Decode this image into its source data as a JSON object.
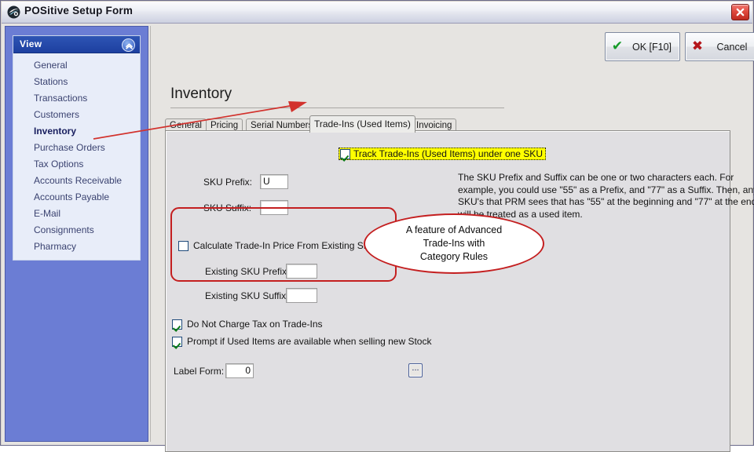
{
  "window": {
    "title": "POSitive Setup Form",
    "icon": "app-logo-icon",
    "close_label": "✕"
  },
  "sidebar": {
    "header": "View",
    "collapse_icon": "chevron-up-circle-icon",
    "items": [
      {
        "label": "General",
        "active": false
      },
      {
        "label": "Stations",
        "active": false
      },
      {
        "label": "Transactions",
        "active": false
      },
      {
        "label": "Customers",
        "active": false
      },
      {
        "label": "Inventory",
        "active": true
      },
      {
        "label": "Purchase Orders",
        "active": false
      },
      {
        "label": "Tax Options",
        "active": false
      },
      {
        "label": "Accounts Receivable",
        "active": false
      },
      {
        "label": "Accounts Payable",
        "active": false
      },
      {
        "label": "E-Mail",
        "active": false
      },
      {
        "label": "Consignments",
        "active": false
      },
      {
        "label": "Pharmacy",
        "active": false
      }
    ]
  },
  "toolbar": {
    "ok_label": "OK [F10]",
    "ok_icon": "check-icon",
    "cancel_label": "Cancel",
    "cancel_icon": "x-icon"
  },
  "main": {
    "page_title": "Inventory",
    "tabs": [
      {
        "label": "General",
        "active": false
      },
      {
        "label": "Pricing",
        "active": false
      },
      {
        "label": "Serial Numbers",
        "active": false
      },
      {
        "label": "Trade-Ins (Used Items)",
        "active": true
      },
      {
        "label": "Invoicing",
        "active": false
      }
    ]
  },
  "form": {
    "track_tradeins": {
      "label": "Track Trade-Ins (Used Items) under one SKU",
      "checked": true,
      "highlight_color": "#ffff00"
    },
    "sku_prefix": {
      "label": "SKU Prefix:",
      "value": "U",
      "placeholder": ""
    },
    "sku_suffix": {
      "label": "SKU Suffix:",
      "value": "",
      "placeholder": ""
    },
    "help_text": "The SKU Prefix and Suffix can be one or two characters each.  For example, you could use \"55\" as a Prefix, and \"77\" as a Suffix.  Then, any SKU's that PRM sees that has \"55\" at the beginning and \"77\" at the end will be treated as a used item.",
    "calculate_price": {
      "label": "Calculate Trade-In Price From Existing SKU",
      "checked": false
    },
    "existing_sku_prefix": {
      "label": "Existing SKU Prefix:",
      "value": "",
      "placeholder": ""
    },
    "existing_sku_suffix": {
      "label": "Existing SKU Suffix:",
      "value": "",
      "placeholder": ""
    },
    "no_tax": {
      "label": "Do Not Charge Tax on Trade-Ins",
      "checked": true
    },
    "prompt_used": {
      "label": "Prompt if Used Items are available when selling new Stock",
      "checked": true
    },
    "label_form": {
      "label": "Label Form:",
      "value": "0",
      "placeholder": ""
    },
    "label_form_browse": "..."
  },
  "annotations": {
    "callout_text": "A feature of Advanced\nTrade-Ins with\nCategory Rules",
    "callout_color": "#c41f20",
    "arrow_color": "#d2322d",
    "arrow_from": "sidebar-item-inventory",
    "arrow_to": "tab-trade-ins"
  }
}
